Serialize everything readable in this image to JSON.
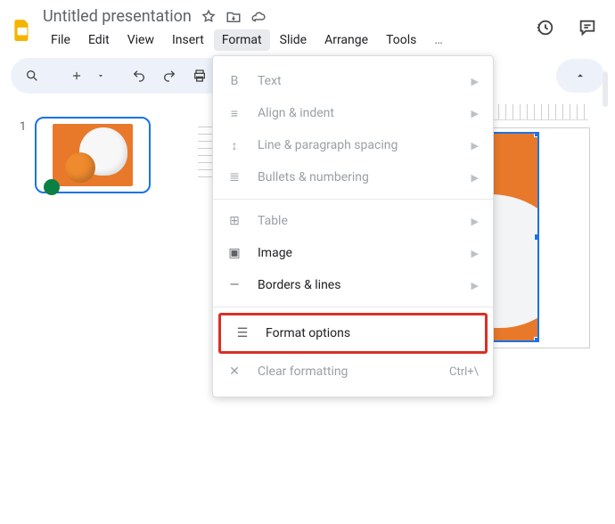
{
  "header": {
    "doc_title": "Untitled presentation",
    "menus": [
      "File",
      "Edit",
      "View",
      "Insert",
      "Format",
      "Slide",
      "Arrange",
      "Tools"
    ],
    "active_menu_index": 4,
    "more": "…"
  },
  "filmstrip": {
    "slides": [
      {
        "number": "1"
      }
    ]
  },
  "format_menu": {
    "items": [
      {
        "icon": "B",
        "icon_name": "bold-icon",
        "label": "Text",
        "submenu": true,
        "enabled": false
      },
      {
        "icon": "≡",
        "icon_name": "align-icon",
        "label": "Align & indent",
        "submenu": true,
        "enabled": false
      },
      {
        "icon": "↕",
        "icon_name": "line-spacing-icon",
        "label": "Line & paragraph spacing",
        "submenu": true,
        "enabled": false
      },
      {
        "icon": "≣",
        "icon_name": "list-icon",
        "label": "Bullets & numbering",
        "submenu": true,
        "enabled": false
      },
      {
        "separator": true
      },
      {
        "icon": "⊞",
        "icon_name": "table-icon",
        "label": "Table",
        "submenu": true,
        "enabled": false
      },
      {
        "icon": "▣",
        "icon_name": "image-icon",
        "label": "Image",
        "submenu": true,
        "enabled": true
      },
      {
        "icon": "—",
        "icon_name": "borders-icon",
        "label": "Borders & lines",
        "submenu": true,
        "enabled": true
      },
      {
        "separator": true
      },
      {
        "icon": "☰",
        "icon_name": "format-options-icon",
        "label": "Format options",
        "submenu": false,
        "enabled": true,
        "highlighted": true
      },
      {
        "icon": "✕",
        "icon_name": "clear-format-icon",
        "label": "Clear formatting",
        "submenu": false,
        "enabled": false,
        "shortcut": "Ctrl+\\"
      }
    ]
  }
}
